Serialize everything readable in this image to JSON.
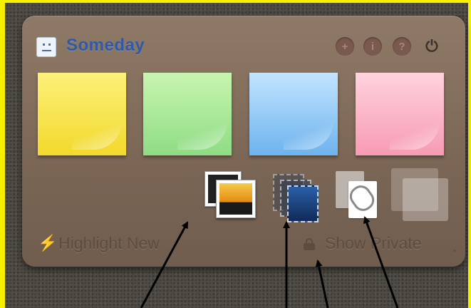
{
  "widget": {
    "title": "Someday",
    "header_buttons": [
      {
        "icon": "add-icon",
        "glyph": "+"
      },
      {
        "icon": "info-icon",
        "glyph": "i"
      },
      {
        "icon": "help-icon",
        "glyph": "?"
      },
      {
        "icon": "power-icon",
        "glyph": "⏻"
      }
    ],
    "notes": [
      {
        "color": "yellow"
      },
      {
        "color": "green"
      },
      {
        "color": "blue"
      },
      {
        "color": "pink"
      }
    ],
    "media_tiles": [
      "photo-icon",
      "film-icon",
      "paperclip-icon",
      "blank-tile-icon"
    ],
    "footer": {
      "highlight_icon": "⚡",
      "highlight_label": "Highlight New",
      "private_label": "Show Private",
      "corner_glyph": "⌃"
    }
  }
}
